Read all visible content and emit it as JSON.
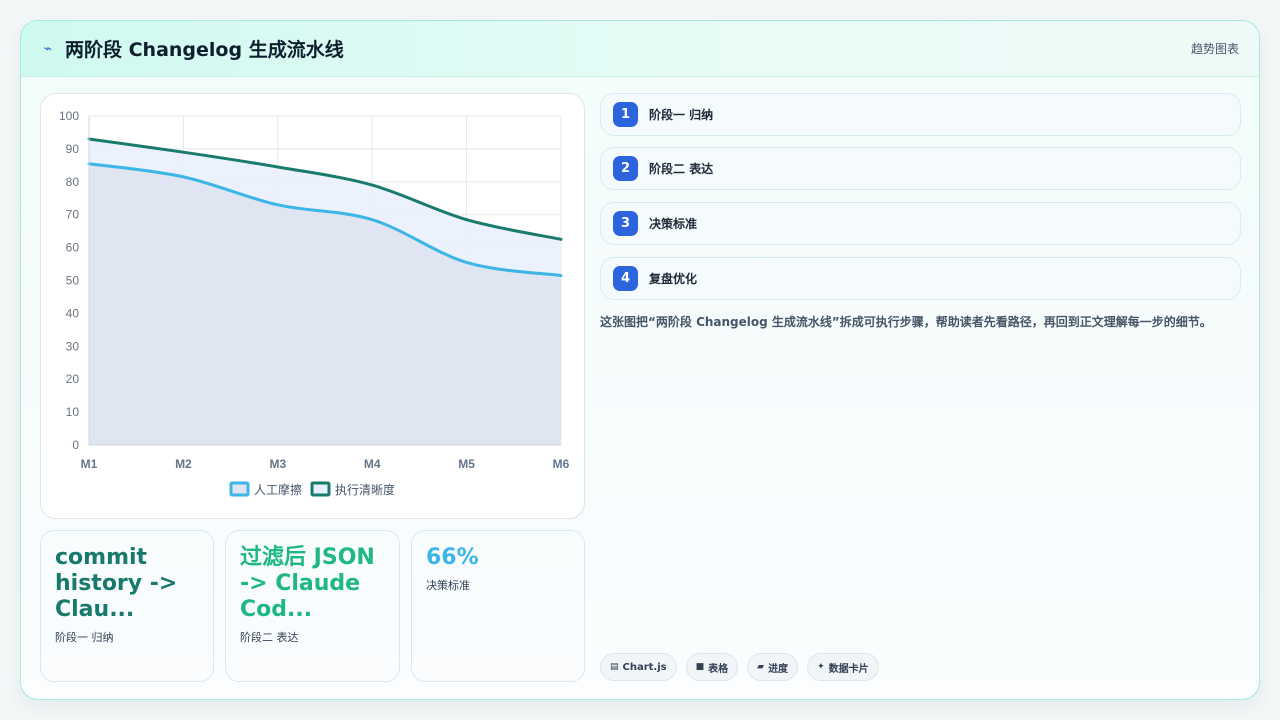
{
  "header": {
    "icon": "sparkline-icon",
    "title": "两阶段 Changelog 生成流水线",
    "tag": "趋势图表"
  },
  "colors": {
    "series1": "#3db5e6",
    "series2": "#197a6e",
    "fill1": "#dde3ef",
    "fill2": "#e8f0fd",
    "accent": "#2b64dd"
  },
  "chart_data": {
    "type": "area",
    "categories": [
      "M1",
      "M2",
      "M3",
      "M4",
      "M5",
      "M6"
    ],
    "series": [
      {
        "name": "人工摩擦",
        "values": [
          85.5,
          81.5,
          73,
          68.5,
          55.5,
          51.5
        ]
      },
      {
        "name": "执行清晰度",
        "values": [
          93,
          89,
          84.5,
          79,
          68.5,
          62.5
        ]
      }
    ],
    "ylim": [
      0,
      100
    ],
    "yticks": [
      0,
      10,
      20,
      30,
      40,
      50,
      60,
      70,
      80,
      90,
      100
    ],
    "grid": true,
    "legend": "bottom"
  },
  "stats": [
    {
      "value": "commit history -> Clau...",
      "label": "阶段一 归纳",
      "color": "#187a6c"
    },
    {
      "value": "过滤后 JSON -> Claude Cod...",
      "label": "阶段二 表达",
      "color": "#1fb784"
    },
    {
      "value": "66%",
      "label": "决策标准",
      "color": "#3db5e6"
    }
  ],
  "steps": [
    {
      "num": "1",
      "label": "阶段一 归纳"
    },
    {
      "num": "2",
      "label": "阶段二 表达"
    },
    {
      "num": "3",
      "label": "决策标准"
    },
    {
      "num": "4",
      "label": "复盘优化"
    }
  ],
  "description": "这张图把“两阶段 Changelog 生成流水线”拆成可执行步骤，帮助读者先看路径，再回到正文理解每一步的细节。",
  "chips": [
    {
      "icon": "chart-icon",
      "glyph": "▤",
      "label": "Chart.js"
    },
    {
      "icon": "table-icon",
      "glyph": "■",
      "label": "表格"
    },
    {
      "icon": "progress-icon",
      "glyph": "▰",
      "label": "进度"
    },
    {
      "icon": "card-icon",
      "glyph": "✦",
      "label": "数据卡片"
    }
  ]
}
